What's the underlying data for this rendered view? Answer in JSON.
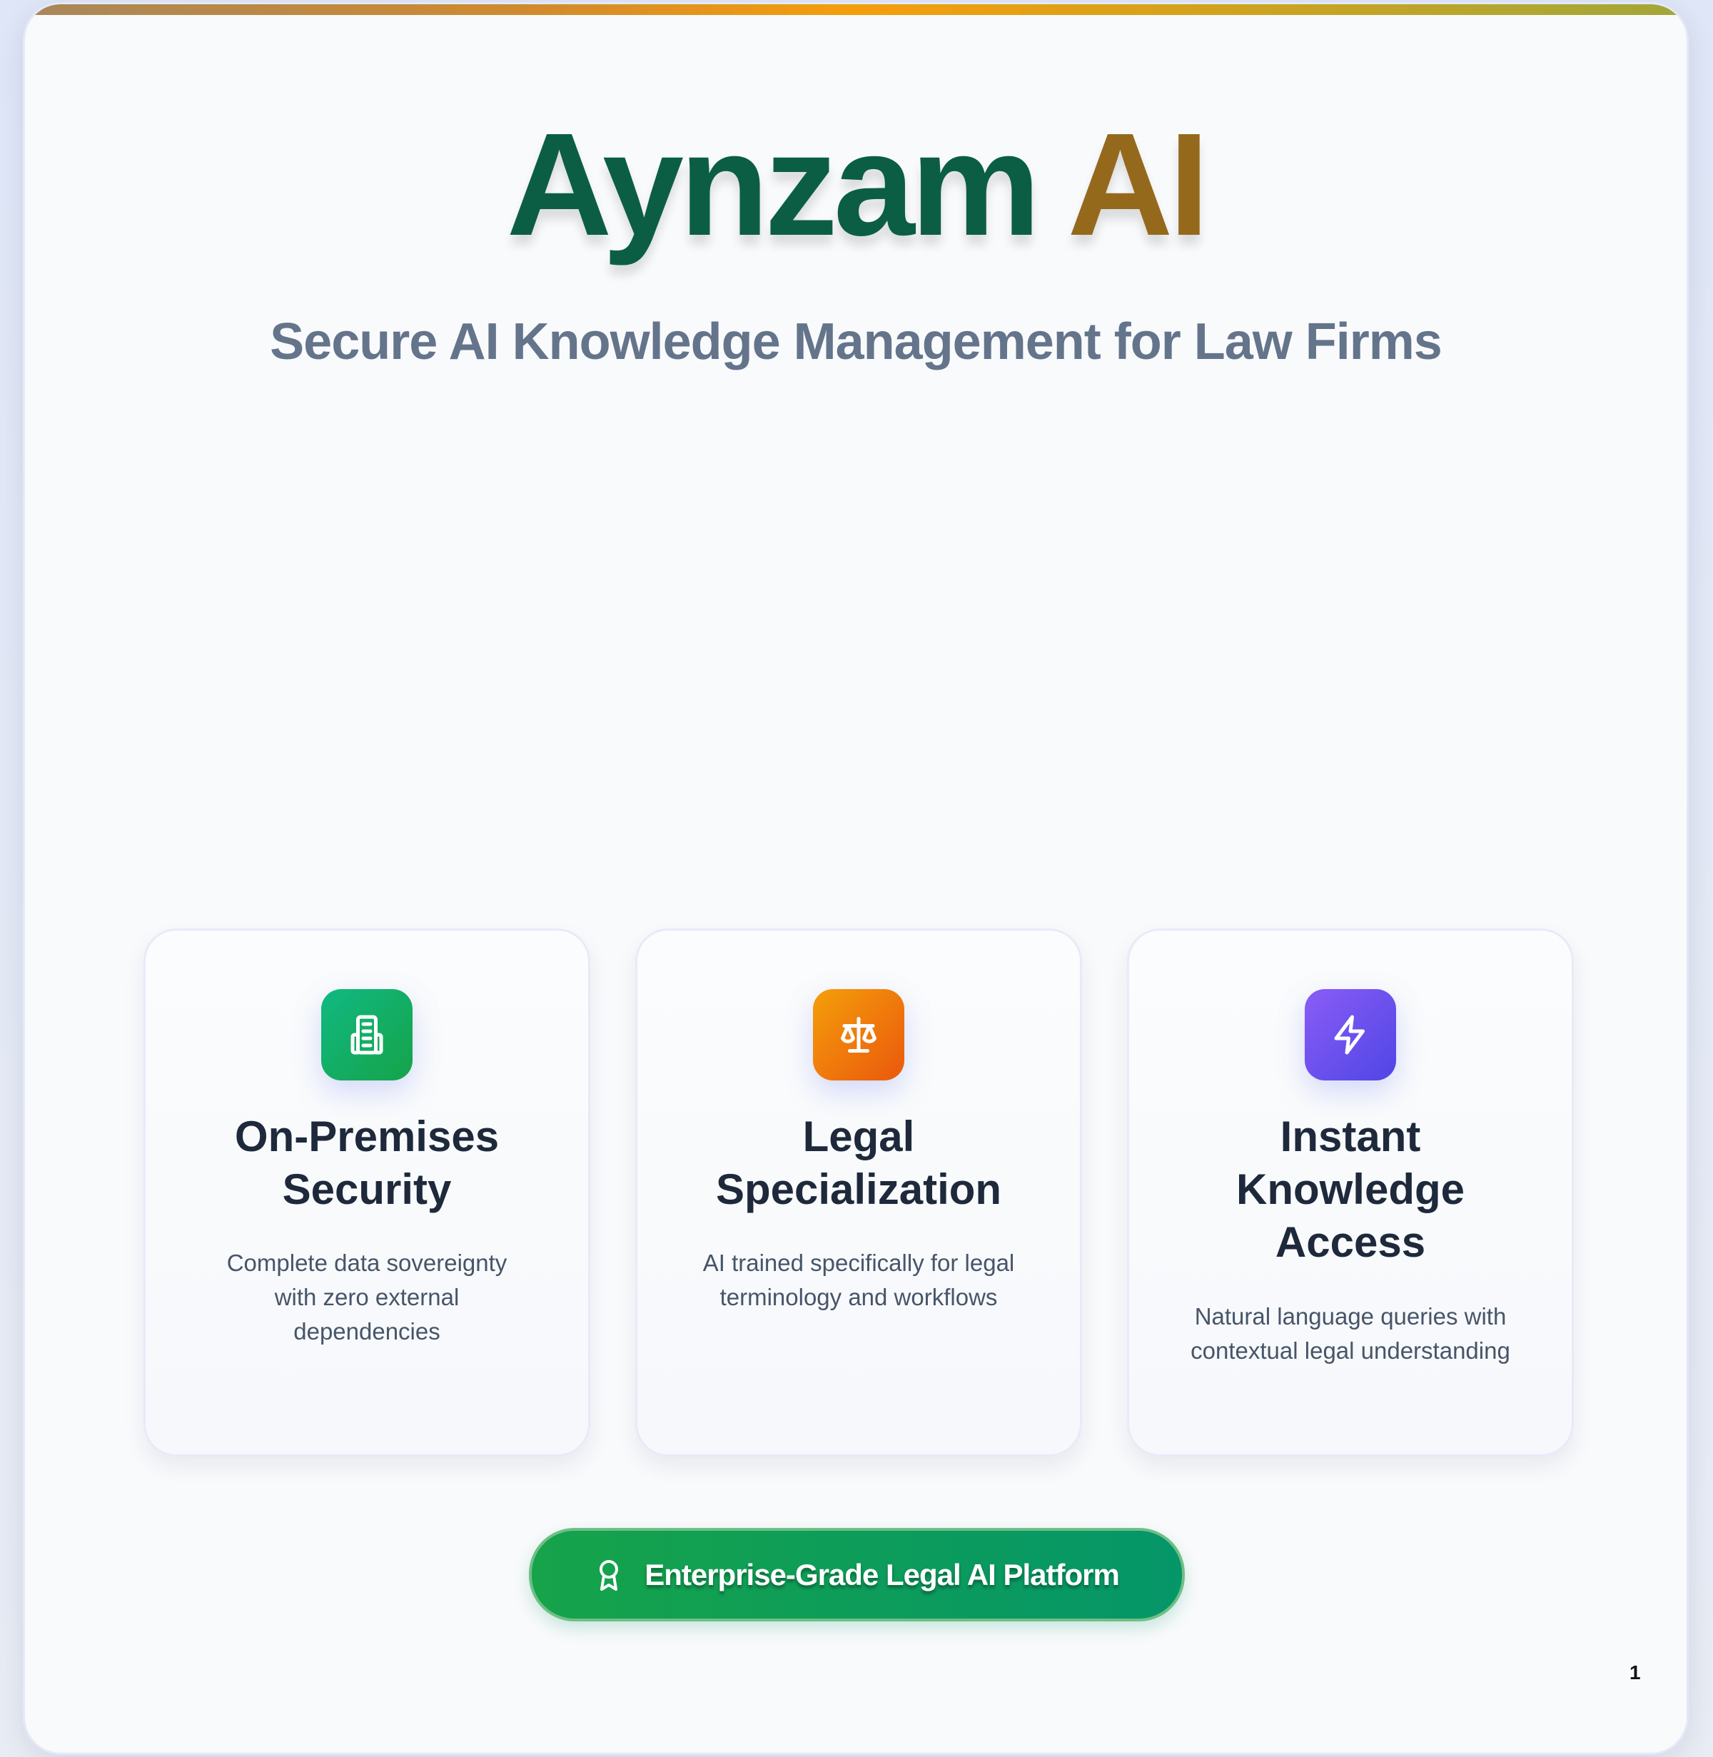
{
  "header": {
    "title_part1": "Aynzam",
    "title_part2": "AI",
    "subtitle": "Secure AI Knowledge Management for Law Firms"
  },
  "features": [
    {
      "icon": "building-icon",
      "title": "On-Premises Security",
      "description": "Complete data sovereignty with zero external dependencies",
      "color": "#10b981"
    },
    {
      "icon": "scale-icon",
      "title": "Legal Specialization",
      "description": "AI trained specifically for legal terminology and workflows",
      "color": "#f97316"
    },
    {
      "icon": "lightning-icon",
      "title": "Instant Knowledge Access",
      "description": "Natural language queries with contextual legal understanding",
      "color": "#7c3aed"
    }
  ],
  "badge": {
    "icon": "award-icon",
    "label": "Enterprise-Grade Legal AI Platform"
  },
  "page_number": "1",
  "colors": {
    "brand_green": "#0b5e44",
    "brand_gold": "#95691c",
    "subtitle": "#64748b"
  }
}
